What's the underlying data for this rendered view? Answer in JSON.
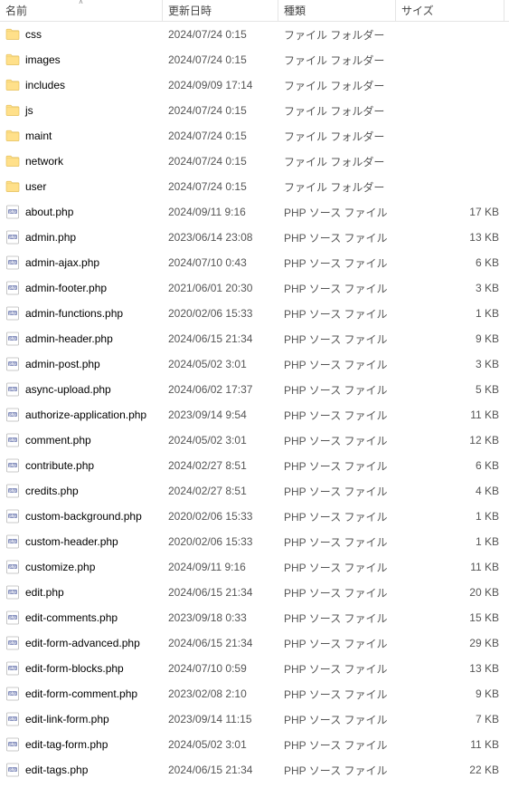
{
  "columns": {
    "name": "名前",
    "date": "更新日時",
    "type": "種類",
    "size": "サイズ"
  },
  "type_labels": {
    "folder": "ファイル フォルダー",
    "php": "PHP ソース ファイル"
  },
  "items": [
    {
      "name": "css",
      "date": "2024/07/24 0:15",
      "kind": "folder",
      "size": ""
    },
    {
      "name": "images",
      "date": "2024/07/24 0:15",
      "kind": "folder",
      "size": ""
    },
    {
      "name": "includes",
      "date": "2024/09/09 17:14",
      "kind": "folder",
      "size": ""
    },
    {
      "name": "js",
      "date": "2024/07/24 0:15",
      "kind": "folder",
      "size": ""
    },
    {
      "name": "maint",
      "date": "2024/07/24 0:15",
      "kind": "folder",
      "size": ""
    },
    {
      "name": "network",
      "date": "2024/07/24 0:15",
      "kind": "folder",
      "size": ""
    },
    {
      "name": "user",
      "date": "2024/07/24 0:15",
      "kind": "folder",
      "size": ""
    },
    {
      "name": "about.php",
      "date": "2024/09/11 9:16",
      "kind": "php",
      "size": "17 KB"
    },
    {
      "name": "admin.php",
      "date": "2023/06/14 23:08",
      "kind": "php",
      "size": "13 KB"
    },
    {
      "name": "admin-ajax.php",
      "date": "2024/07/10 0:43",
      "kind": "php",
      "size": "6 KB"
    },
    {
      "name": "admin-footer.php",
      "date": "2021/06/01 20:30",
      "kind": "php",
      "size": "3 KB"
    },
    {
      "name": "admin-functions.php",
      "date": "2020/02/06 15:33",
      "kind": "php",
      "size": "1 KB"
    },
    {
      "name": "admin-header.php",
      "date": "2024/06/15 21:34",
      "kind": "php",
      "size": "9 KB"
    },
    {
      "name": "admin-post.php",
      "date": "2024/05/02 3:01",
      "kind": "php",
      "size": "3 KB"
    },
    {
      "name": "async-upload.php",
      "date": "2024/06/02 17:37",
      "kind": "php",
      "size": "5 KB"
    },
    {
      "name": "authorize-application.php",
      "date": "2023/09/14 9:54",
      "kind": "php",
      "size": "11 KB"
    },
    {
      "name": "comment.php",
      "date": "2024/05/02 3:01",
      "kind": "php",
      "size": "12 KB"
    },
    {
      "name": "contribute.php",
      "date": "2024/02/27 8:51",
      "kind": "php",
      "size": "6 KB"
    },
    {
      "name": "credits.php",
      "date": "2024/02/27 8:51",
      "kind": "php",
      "size": "4 KB"
    },
    {
      "name": "custom-background.php",
      "date": "2020/02/06 15:33",
      "kind": "php",
      "size": "1 KB"
    },
    {
      "name": "custom-header.php",
      "date": "2020/02/06 15:33",
      "kind": "php",
      "size": "1 KB"
    },
    {
      "name": "customize.php",
      "date": "2024/09/11 9:16",
      "kind": "php",
      "size": "11 KB"
    },
    {
      "name": "edit.php",
      "date": "2024/06/15 21:34",
      "kind": "php",
      "size": "20 KB"
    },
    {
      "name": "edit-comments.php",
      "date": "2023/09/18 0:33",
      "kind": "php",
      "size": "15 KB"
    },
    {
      "name": "edit-form-advanced.php",
      "date": "2024/06/15 21:34",
      "kind": "php",
      "size": "29 KB"
    },
    {
      "name": "edit-form-blocks.php",
      "date": "2024/07/10 0:59",
      "kind": "php",
      "size": "13 KB"
    },
    {
      "name": "edit-form-comment.php",
      "date": "2023/02/08 2:10",
      "kind": "php",
      "size": "9 KB"
    },
    {
      "name": "edit-link-form.php",
      "date": "2023/09/14 11:15",
      "kind": "php",
      "size": "7 KB"
    },
    {
      "name": "edit-tag-form.php",
      "date": "2024/05/02 3:01",
      "kind": "php",
      "size": "11 KB"
    },
    {
      "name": "edit-tags.php",
      "date": "2024/06/15 21:34",
      "kind": "php",
      "size": "22 KB"
    }
  ]
}
